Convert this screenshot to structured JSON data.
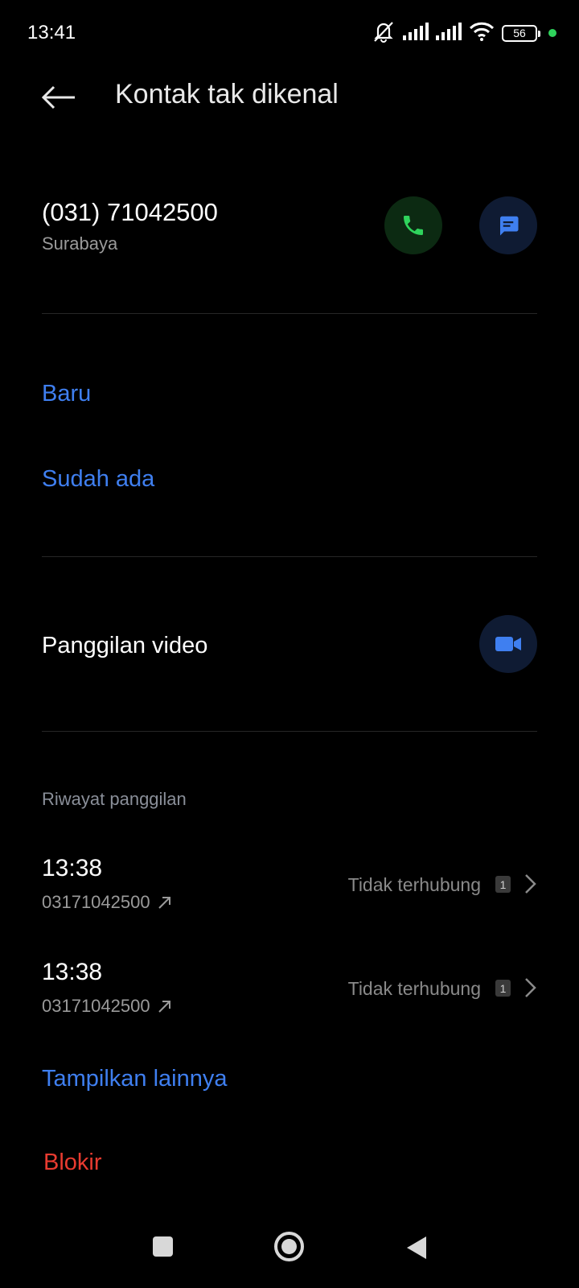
{
  "status_bar": {
    "time": "13:41",
    "battery": "56",
    "icons": [
      "muted-bell-icon",
      "signal-icon",
      "signal-icon",
      "wifi-icon",
      "battery-icon",
      "privacy-dot-icon"
    ]
  },
  "header": {
    "title": "Kontak tak dikenal",
    "back_icon": "arrow-left-icon"
  },
  "contact": {
    "number": "(031) 71042500",
    "location": "Surabaya",
    "call_icon": "phone-icon",
    "message_icon": "message-icon"
  },
  "add_contact": {
    "new_label": "Baru",
    "existing_label": "Sudah ada"
  },
  "video_call": {
    "label": "Panggilan video",
    "icon": "video-camera-icon"
  },
  "call_history": {
    "section_label": "Riwayat panggilan",
    "entries": [
      {
        "time": "13:38",
        "number": "03171042500",
        "status": "Tidak terhubung",
        "count": "1"
      },
      {
        "time": "13:38",
        "number": "03171042500",
        "status": "Tidak terhubung",
        "count": "1"
      }
    ],
    "show_more_label": "Tampilkan lainnya"
  },
  "block_label": "Blokir",
  "colors": {
    "accent_blue": "#3f7ff0",
    "danger_red": "#e83b30",
    "call_green": "#2fd35c",
    "background": "#000000"
  }
}
